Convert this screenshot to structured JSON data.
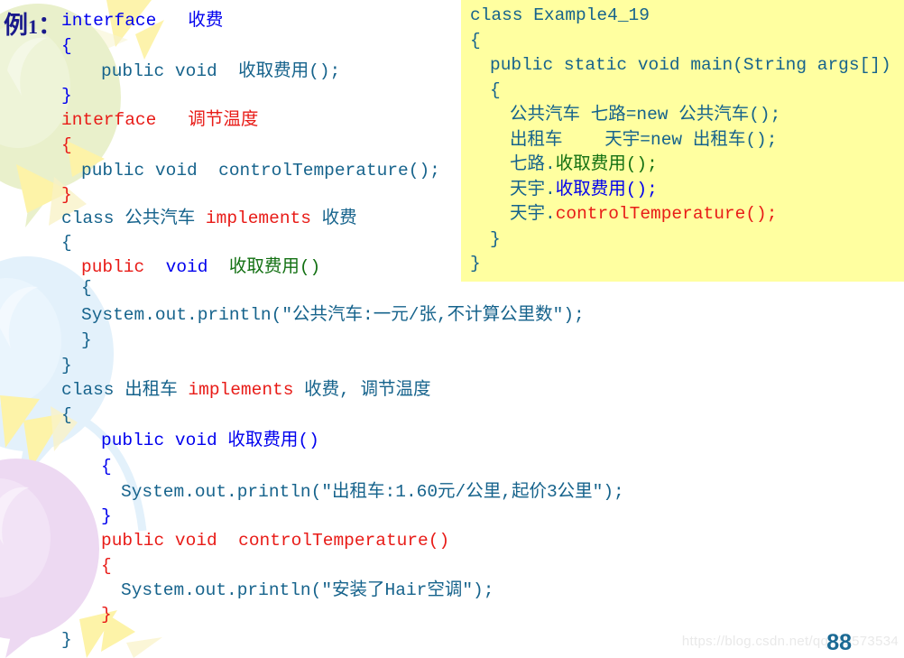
{
  "slide": {
    "example_label_prefix": "例",
    "example_label_number": "1",
    "example_label_suffix": "：",
    "page_number": "88",
    "watermark": "https://blog.csdn.net/qq_35573534"
  },
  "colors": {
    "blue": "#0000ee",
    "red": "#e81b17",
    "teal": "#16638c",
    "green": "#127012",
    "box_background": "#ffffa0",
    "page_number": "#1b6a94",
    "watermark": "#e9e9e9",
    "balloon_green": "#e8f0c8",
    "balloon_blue": "#ddeefb",
    "balloon_purple": "#eedcf2",
    "ray_yellow": "#fdf3a8"
  },
  "left_listing": {
    "lines": [
      {
        "indent": 0,
        "tokens": [
          {
            "t": "interface   收费",
            "c": "blue"
          }
        ]
      },
      {
        "indent": 0,
        "tokens": [
          {
            "t": "{",
            "c": "blue"
          }
        ]
      },
      {
        "indent": 2,
        "tokens": [
          {
            "t": "public void  收取费用();",
            "c": "teal"
          }
        ]
      },
      {
        "indent": 0,
        "tokens": [
          {
            "t": "}",
            "c": "blue"
          }
        ]
      },
      {
        "indent": 0,
        "tokens": [
          {
            "t": "interface   调节温度",
            "c": "red"
          }
        ]
      },
      {
        "indent": 0,
        "tokens": [
          {
            "t": "{",
            "c": "red"
          }
        ]
      },
      {
        "indent": 1,
        "tokens": [
          {
            "t": "public void  controlTemperature();",
            "c": "teal"
          }
        ]
      },
      {
        "indent": 0,
        "tokens": [
          {
            "t": "}",
            "c": "red"
          }
        ]
      },
      {
        "indent": 0,
        "tokens": [
          {
            "t": "class 公共汽车 ",
            "c": "teal"
          },
          {
            "t": "implements",
            "c": "red"
          },
          {
            "t": " 收费",
            "c": "teal"
          }
        ]
      },
      {
        "indent": 0,
        "tokens": [
          {
            "t": "{",
            "c": "teal"
          }
        ]
      },
      {
        "indent": 1,
        "tokens": [
          {
            "t": "public",
            "c": "red"
          },
          {
            "t": "  ",
            "c": "teal"
          },
          {
            "t": "void",
            "c": "blue"
          },
          {
            "t": "  ",
            "c": "teal"
          },
          {
            "t": "收取费用()",
            "c": "green"
          }
        ]
      },
      {
        "indent": 1,
        "tokens": [
          {
            "t": "{",
            "c": "teal"
          }
        ]
      },
      {
        "indent": 1,
        "tokens": [
          {
            "t": "System.out.println(\"公共汽车:一元/张,不计算公里数\");",
            "c": "teal"
          }
        ]
      },
      {
        "indent": 1,
        "tokens": [
          {
            "t": "}",
            "c": "teal"
          }
        ]
      },
      {
        "indent": 0,
        "tokens": [
          {
            "t": "}",
            "c": "teal"
          }
        ]
      },
      {
        "indent": 0,
        "tokens": [
          {
            "t": "class 出租车 ",
            "c": "teal"
          },
          {
            "t": "implements",
            "c": "red"
          },
          {
            "t": " 收费, 调节温度",
            "c": "teal"
          }
        ]
      },
      {
        "indent": 0,
        "tokens": [
          {
            "t": "{",
            "c": "teal"
          }
        ]
      },
      {
        "indent": 2,
        "tokens": [
          {
            "t": "public void 收取费用()",
            "c": "blue"
          }
        ]
      },
      {
        "indent": 2,
        "tokens": [
          {
            "t": "{",
            "c": "blue"
          }
        ]
      },
      {
        "indent": 3,
        "tokens": [
          {
            "t": "System.out.println(\"出租车:1.60元/公里,起价3公里\");",
            "c": "teal"
          }
        ]
      },
      {
        "indent": 2,
        "tokens": [
          {
            "t": "}",
            "c": "blue"
          }
        ]
      },
      {
        "indent": 2,
        "tokens": [
          {
            "t": "public void  controlTemperature()",
            "c": "red"
          }
        ]
      },
      {
        "indent": 2,
        "tokens": [
          {
            "t": "{",
            "c": "red"
          }
        ]
      },
      {
        "indent": 3,
        "tokens": [
          {
            "t": "System.out.println(\"安装了Hair空调\");",
            "c": "teal"
          }
        ]
      },
      {
        "indent": 2,
        "tokens": [
          {
            "t": "}",
            "c": "red"
          }
        ]
      },
      {
        "indent": 0,
        "tokens": [
          {
            "t": "}",
            "c": "teal"
          }
        ]
      }
    ]
  },
  "right_box": {
    "lines": [
      {
        "indent": 0,
        "tokens": [
          {
            "t": "class Example4_19",
            "c": "teal"
          }
        ]
      },
      {
        "indent": 0,
        "tokens": [
          {
            "t": "{",
            "c": "teal"
          }
        ]
      },
      {
        "indent": 1,
        "tokens": [
          {
            "t": "public static void main(String args[])",
            "c": "teal"
          }
        ]
      },
      {
        "indent": 1,
        "tokens": [
          {
            "t": "{",
            "c": "teal"
          }
        ]
      },
      {
        "indent": 2,
        "tokens": [
          {
            "t": "公共汽车 七路=new 公共汽车();",
            "c": "teal"
          }
        ]
      },
      {
        "indent": 2,
        "tokens": [
          {
            "t": "出租车    天宇=new 出租车();",
            "c": "teal"
          }
        ]
      },
      {
        "indent": 2,
        "tokens": [
          {
            "t": "七路.",
            "c": "teal"
          },
          {
            "t": "收取费用();",
            "c": "green"
          }
        ]
      },
      {
        "indent": 2,
        "tokens": [
          {
            "t": "天宇.",
            "c": "teal"
          },
          {
            "t": "收取费用();",
            "c": "blue"
          }
        ]
      },
      {
        "indent": 2,
        "tokens": [
          {
            "t": "天宇.",
            "c": "teal"
          },
          {
            "t": "controlTemperature();",
            "c": "red"
          }
        ]
      },
      {
        "indent": 1,
        "tokens": [
          {
            "t": "}",
            "c": "teal"
          }
        ]
      },
      {
        "indent": 0,
        "tokens": [
          {
            "t": "}",
            "c": "teal"
          }
        ]
      }
    ]
  }
}
